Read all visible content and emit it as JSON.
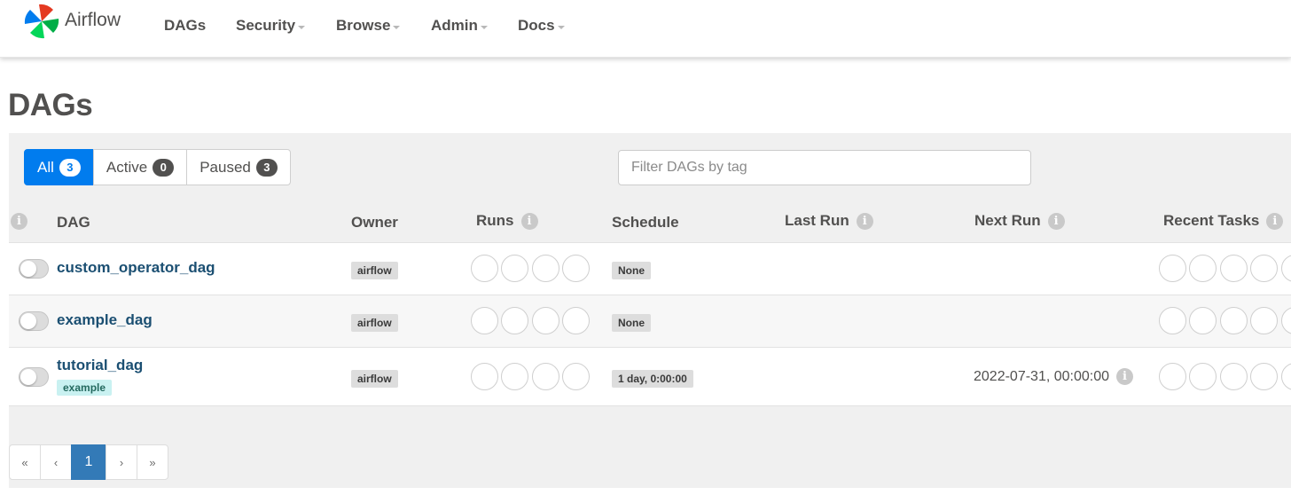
{
  "brand": {
    "name": "Airflow"
  },
  "nav": [
    "DAGs",
    "Security",
    "Browse",
    "Admin",
    "Docs"
  ],
  "page": {
    "title": "DAGs"
  },
  "filters": {
    "all": {
      "label": "All",
      "count": "3"
    },
    "active": {
      "label": "Active",
      "count": "0"
    },
    "paused": {
      "label": "Paused",
      "count": "3"
    }
  },
  "tag_filter": {
    "placeholder": "Filter DAGs by tag",
    "value": ""
  },
  "table": {
    "headers": {
      "dag": "DAG",
      "owner": "Owner",
      "runs": "Runs",
      "schedule": "Schedule",
      "last_run": "Last Run",
      "next_run": "Next Run",
      "recent_tasks": "Recent Tasks"
    },
    "rows": [
      {
        "dag_id": "custom_operator_dag",
        "tags": [],
        "owner": "airflow",
        "schedule": "None",
        "next_run": ""
      },
      {
        "dag_id": "example_dag",
        "tags": [],
        "owner": "airflow",
        "schedule": "None",
        "next_run": ""
      },
      {
        "dag_id": "tutorial_dag",
        "tags": [
          "example"
        ],
        "owner": "airflow",
        "schedule": "1 day, 0:00:00",
        "next_run": "2022-07-31, 00:00:00"
      }
    ]
  },
  "info_glyph": "i",
  "pagination": {
    "first": "«",
    "prev": "‹",
    "current": "1",
    "next": "›",
    "last": "»"
  },
  "icons": [
    "airflow-logo-icon",
    "info-icon",
    "caret-down-icon"
  ],
  "colors": {
    "primary": "#017cee",
    "link": "#1b4f72",
    "page_active": "#337ab7",
    "tag_bg": "#c9f1f1"
  }
}
